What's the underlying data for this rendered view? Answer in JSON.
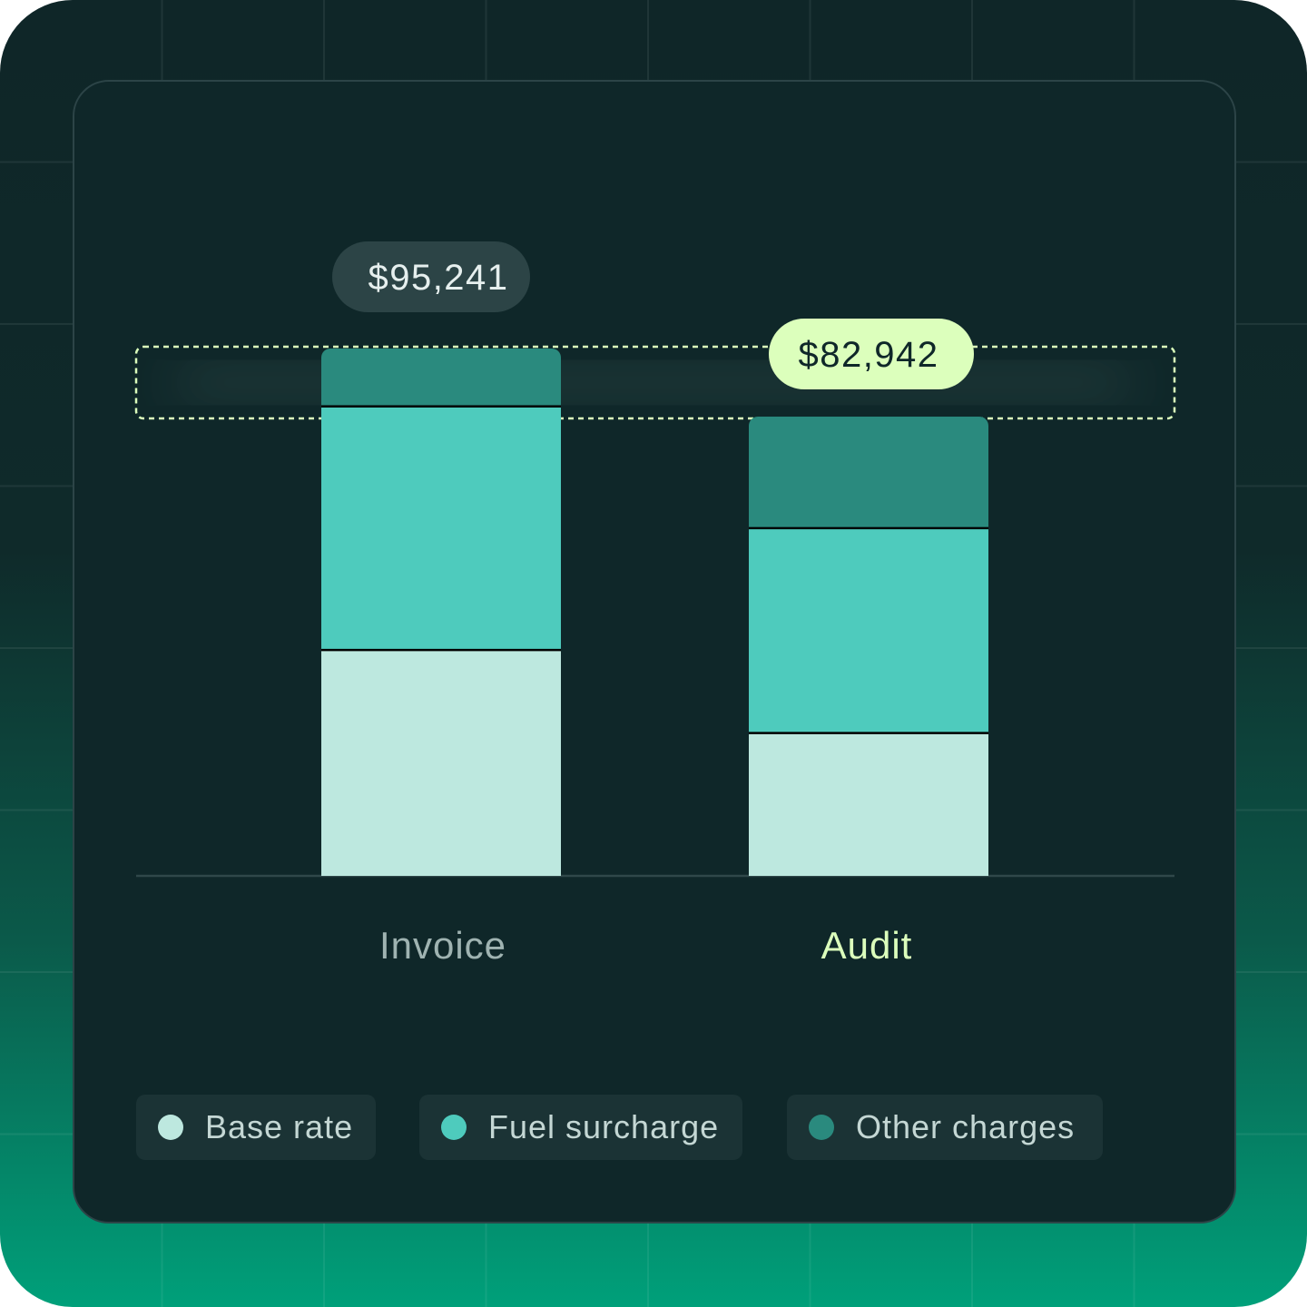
{
  "colors": {
    "base_rate": "#bde8df",
    "fuel_surcharge": "#4ecbbd",
    "other_charges": "#2a8a7e",
    "invoice_pill_bg": "#2c4446",
    "invoice_pill_text": "#e6efee",
    "audit_pill_bg": "#dcffbc",
    "audit_pill_text": "#0f2729",
    "invoice_label": "#9fb3b1",
    "audit_label": "#dcffbc",
    "highlight_border": "#dcffbc"
  },
  "chart_data": {
    "type": "bar",
    "stacked": true,
    "categories": [
      "Invoice",
      "Audit"
    ],
    "series": [
      {
        "name": "Base rate",
        "values": [
          41000,
          26000
        ]
      },
      {
        "name": "Fuel surcharge",
        "values": [
          44000,
          37000
        ]
      },
      {
        "name": "Other charges",
        "values": [
          10241,
          19942
        ]
      }
    ],
    "totals": [
      "$95,241",
      "$82,942"
    ],
    "total_values": [
      95241,
      82942
    ],
    "ylim": [
      0,
      100000
    ],
    "grid": false,
    "legend": "bottom",
    "highlighted_category": "Audit"
  }
}
